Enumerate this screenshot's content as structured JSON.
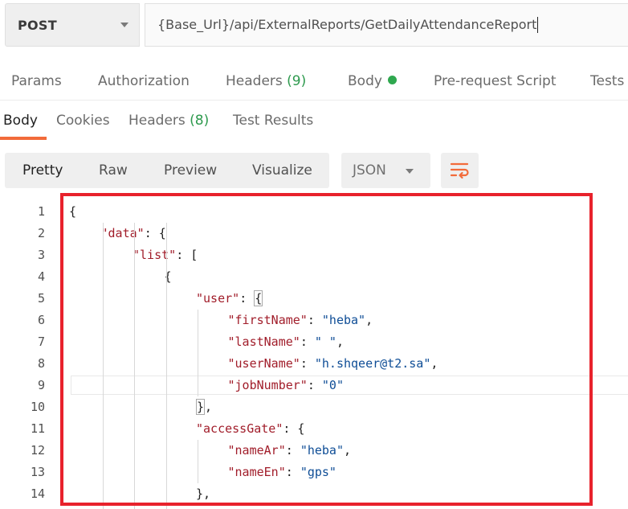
{
  "request": {
    "method": "POST",
    "url": "{Base_Url}/api/ExternalReports/GetDailyAttendanceReport"
  },
  "request_tabs": [
    {
      "label": "Params"
    },
    {
      "label": "Authorization"
    },
    {
      "label": "Headers",
      "count": "(9)"
    },
    {
      "label": "Body",
      "indicator": "green-dot"
    },
    {
      "label": "Pre-request Script"
    },
    {
      "label": "Tests"
    }
  ],
  "response_tabs": [
    {
      "label": "Body",
      "active": true
    },
    {
      "label": "Cookies"
    },
    {
      "label": "Headers",
      "count": "(8)"
    },
    {
      "label": "Test Results"
    }
  ],
  "view_modes": [
    "Pretty",
    "Raw",
    "Preview",
    "Visualize"
  ],
  "active_view_mode": "Pretty",
  "format": "JSON",
  "icons": {
    "method_dropdown": "chevron-down-icon",
    "format_dropdown": "chevron-down-icon",
    "wrap": "wrap-lines-icon"
  },
  "colors": {
    "accent": "#f26b3a",
    "status_green": "#2fa84f",
    "json_key": "#a11d2a",
    "json_string": "#0e4d96",
    "annotation_box": "#e8222c"
  },
  "code_lines": [
    {
      "n": "1",
      "indent": 0,
      "tokens": [
        {
          "t": "{",
          "c": "p"
        }
      ]
    },
    {
      "n": "2",
      "indent": 1,
      "tokens": [
        {
          "t": "\"data\"",
          "c": "k"
        },
        {
          "t": ": {",
          "c": "p"
        }
      ]
    },
    {
      "n": "3",
      "indent": 2,
      "tokens": [
        {
          "t": "\"list\"",
          "c": "k"
        },
        {
          "t": ": [",
          "c": "p"
        }
      ]
    },
    {
      "n": "4",
      "indent": 3,
      "tokens": [
        {
          "t": "{",
          "c": "p"
        }
      ]
    },
    {
      "n": "5",
      "indent": 4,
      "tokens": [
        {
          "t": "\"user\"",
          "c": "k"
        },
        {
          "t": ": ",
          "c": "p"
        },
        {
          "t": "{",
          "c": "p",
          "match": true
        }
      ]
    },
    {
      "n": "6",
      "indent": 5,
      "tokens": [
        {
          "t": "\"firstName\"",
          "c": "k"
        },
        {
          "t": ": ",
          "c": "p"
        },
        {
          "t": "\"heba\"",
          "c": "s"
        },
        {
          "t": ",",
          "c": "p"
        }
      ]
    },
    {
      "n": "7",
      "indent": 5,
      "tokens": [
        {
          "t": "\"lastName\"",
          "c": "k"
        },
        {
          "t": ": ",
          "c": "p"
        },
        {
          "t": "\" \"",
          "c": "s"
        },
        {
          "t": ",",
          "c": "p"
        }
      ]
    },
    {
      "n": "8",
      "indent": 5,
      "tokens": [
        {
          "t": "\"userName\"",
          "c": "k"
        },
        {
          "t": ": ",
          "c": "p"
        },
        {
          "t": "\"h.shqeer@t2.sa\"",
          "c": "s"
        },
        {
          "t": ",",
          "c": "p"
        }
      ]
    },
    {
      "n": "9",
      "indent": 5,
      "current": true,
      "tokens": [
        {
          "t": "\"jobNumber\"",
          "c": "k"
        },
        {
          "t": ": ",
          "c": "p"
        },
        {
          "t": "\"0\"",
          "c": "s"
        }
      ]
    },
    {
      "n": "10",
      "indent": 4,
      "tokens": [
        {
          "t": "}",
          "c": "p",
          "match": true
        },
        {
          "t": ",",
          "c": "p"
        }
      ]
    },
    {
      "n": "11",
      "indent": 4,
      "tokens": [
        {
          "t": "\"accessGate\"",
          "c": "k"
        },
        {
          "t": ": {",
          "c": "p"
        }
      ]
    },
    {
      "n": "12",
      "indent": 5,
      "tokens": [
        {
          "t": "\"nameAr\"",
          "c": "k"
        },
        {
          "t": ": ",
          "c": "p"
        },
        {
          "t": "\"heba\"",
          "c": "s"
        },
        {
          "t": ",",
          "c": "p"
        }
      ]
    },
    {
      "n": "13",
      "indent": 5,
      "tokens": [
        {
          "t": "\"nameEn\"",
          "c": "k"
        },
        {
          "t": ": ",
          "c": "p"
        },
        {
          "t": "\"gps\"",
          "c": "s"
        }
      ]
    },
    {
      "n": "14",
      "indent": 4,
      "tokens": [
        {
          "t": "}",
          "c": "p"
        },
        {
          "t": ",",
          "c": "p"
        }
      ]
    }
  ]
}
